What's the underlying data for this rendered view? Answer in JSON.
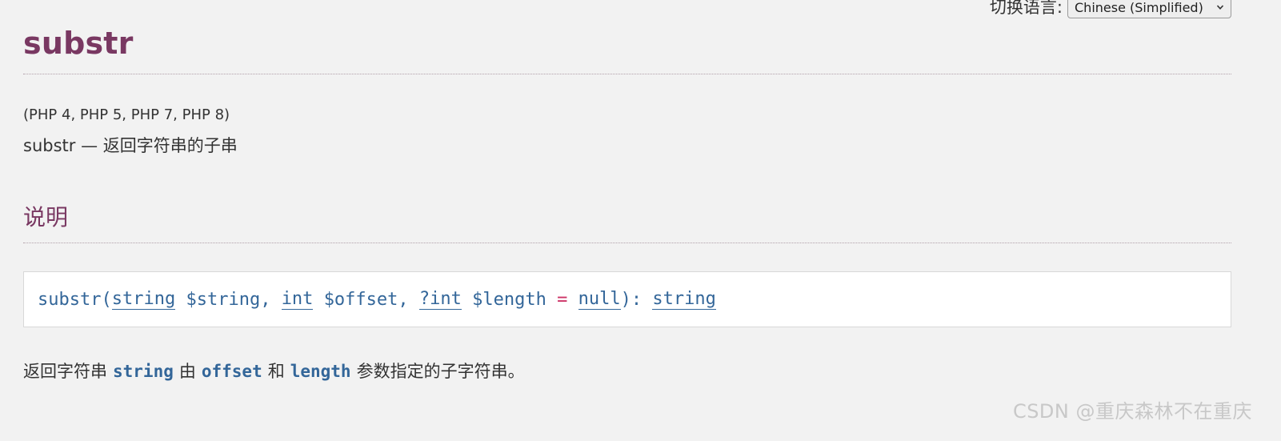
{
  "lang_switch": {
    "label": "切换语言:",
    "selected": "Chinese (Simplified)"
  },
  "refentry": {
    "name": "substr",
    "versions": "(PHP 4, PHP 5, PHP 7, PHP 8)",
    "purpose": "substr — 返回字符串的子串"
  },
  "section": {
    "title": "说明"
  },
  "synopsis": {
    "func": "substr",
    "open": "(",
    "p1_type": "string",
    "p1_var": "$string",
    "sep1": ", ",
    "p2_type": "int",
    "p2_var": "$offset",
    "sep2": ", ",
    "p3_type": "?int",
    "p3_var": "$length",
    "eq": "=",
    "default": "null",
    "close": "): ",
    "return_type": "string"
  },
  "description": {
    "t1": "返回字符串",
    "c1": "string",
    "t2": "由",
    "c2": "offset",
    "t3": "和",
    "c3": "length",
    "t4": "参数指定的子字符串。"
  },
  "watermark": "CSDN @重庆森林不在重庆"
}
